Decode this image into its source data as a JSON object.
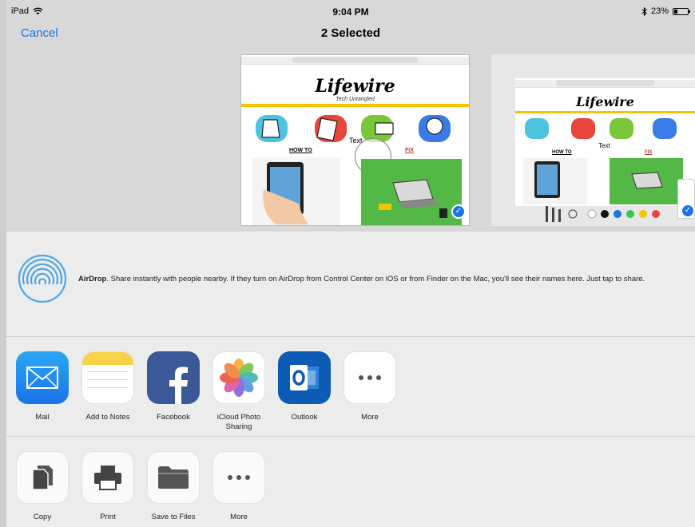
{
  "status": {
    "device": "iPad",
    "time": "9:04 PM",
    "battery": "23%"
  },
  "nav": {
    "cancel_label": "Cancel",
    "title": "2 Selected"
  },
  "preview": {
    "logo": "Lifewire",
    "tagline": "Tech Untangled",
    "section_howto": "HOW TO",
    "section_fix": "FIX",
    "markup_text": "Text"
  },
  "airdrop": {
    "title": "AirDrop",
    "description": ". Share instantly with people nearby. If they turn on AirDrop from Control Center on iOS or from Finder on the Mac, you'll see their names here. Just tap to share."
  },
  "apps": [
    {
      "label": "Mail",
      "icon": "mail-icon"
    },
    {
      "label": "Add to Notes",
      "icon": "notes-icon"
    },
    {
      "label": "Facebook",
      "icon": "facebook-icon"
    },
    {
      "label": "iCloud Photo Sharing",
      "icon": "photos-icon"
    },
    {
      "label": "Outlook",
      "icon": "outlook-icon"
    },
    {
      "label": "More",
      "icon": "more-icon"
    }
  ],
  "actions": [
    {
      "label": "Copy",
      "icon": "copy-icon"
    },
    {
      "label": "Print",
      "icon": "print-icon"
    },
    {
      "label": "Save to Files",
      "icon": "folder-icon"
    },
    {
      "label": "More",
      "icon": "more-icon"
    }
  ],
  "colors": {
    "accent": "#1a73e8",
    "sheet_bg": "#ececec",
    "preview_bg": "#d8d8d8"
  }
}
